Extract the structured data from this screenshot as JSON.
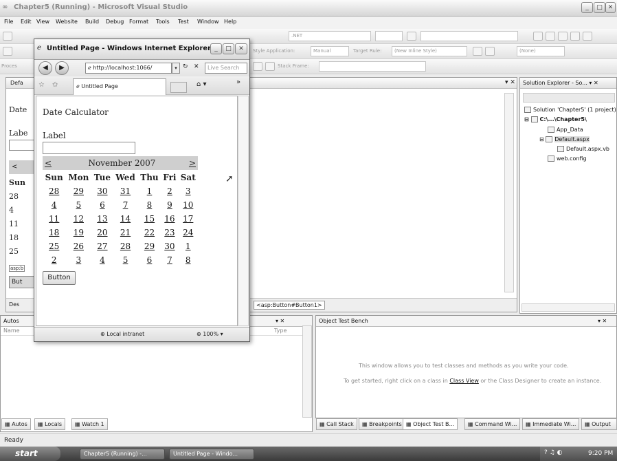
{
  "vs": {
    "title": "Chapter5 (Running) - Microsoft Visual Studio",
    "menu": [
      "File",
      "Edit",
      "View",
      "Website",
      "Build",
      "Debug",
      "Format",
      "Tools",
      "Test",
      "Window",
      "Help"
    ],
    "toolbar": {
      "framework": ".NET",
      "style_application_label": "Style Application:",
      "style_application_value": "Manual",
      "target_rule_label": "Target Rule:",
      "target_rule_value": "(New Inline Style)",
      "none_value": "(None)",
      "stack_frame_label": "Stack Frame:",
      "process_label": "Proces"
    },
    "doc_tab": "Defa",
    "behind_labels": {
      "date": "Date",
      "label": "Labe",
      "prev": "<",
      "sun": "Sun",
      "rows": [
        "28",
        "4",
        "11",
        "18",
        "25"
      ],
      "asp": "asp:b",
      "but": "But",
      "design": "Des",
      "tag_path": "<asp:Button#Button1>"
    },
    "solution_explorer": {
      "title": "Solution Explorer - So...",
      "items": [
        "Solution 'Chapter5' (1 project)",
        "C:\\...\\Chapter5\\",
        "App_Data",
        "Default.aspx",
        "Default.aspx.vb",
        "web.config"
      ]
    },
    "autos": {
      "title": "Autos",
      "col_name": "Name",
      "col_type": "Type"
    },
    "otb": {
      "title": "Object Test Bench",
      "line1": "This window allows you to test classes and methods as you write your code.",
      "line2_pre": "To get started, right click on a class in ",
      "line2_link": "Class View",
      "line2_post": " or the Class Designer to create an instance."
    },
    "bottom_tabs_left": [
      "Autos",
      "Locals",
      "Watch 1"
    ],
    "bottom_tabs_right": [
      "Call Stack",
      "Breakpoints",
      "Object Test B...",
      "Command Wi...",
      "Immediate Wi...",
      "Output"
    ],
    "status": "Ready",
    "taskbar": {
      "start": "start",
      "tasks": [
        "Chapter5 (Running) -...",
        "Untitled Page - Windo..."
      ],
      "time": "9:20 PM"
    }
  },
  "ie": {
    "title": "Untitled Page - Windows Internet Explorer",
    "url": "http://localhost:1066/",
    "search_placeholder": "Live Search",
    "tab_label": "Untitled Page",
    "status_zone": "Local intranet",
    "zoom": "100%",
    "page": {
      "heading": "Date Calculator",
      "label": "Label",
      "textbox_value": "",
      "button": "Button",
      "calendar": {
        "month": "November 2007",
        "prev": "<",
        "next": ">",
        "weekdays": [
          "Sun",
          "Mon",
          "Tue",
          "Wed",
          "Thu",
          "Fri",
          "Sat"
        ],
        "weeks": [
          [
            "28",
            "29",
            "30",
            "31",
            "1",
            "2",
            "3"
          ],
          [
            "4",
            "5",
            "6",
            "7",
            "8",
            "9",
            "10"
          ],
          [
            "11",
            "12",
            "13",
            "14",
            "15",
            "16",
            "17"
          ],
          [
            "18",
            "19",
            "20",
            "21",
            "22",
            "23",
            "24"
          ],
          [
            "25",
            "26",
            "27",
            "28",
            "29",
            "30",
            "1"
          ],
          [
            "2",
            "3",
            "4",
            "5",
            "6",
            "7",
            "8"
          ]
        ]
      }
    }
  }
}
